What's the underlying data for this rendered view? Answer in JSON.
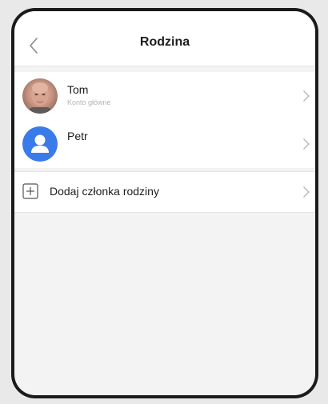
{
  "header": {
    "title": "Rodzina",
    "back_icon": "chevron-left-icon"
  },
  "members": [
    {
      "name": "Tom",
      "subtitle": "Konto główne",
      "avatar": "photo"
    },
    {
      "name": "Petr",
      "subtitle": "",
      "avatar": "default-user-icon"
    }
  ],
  "add_member": {
    "label": "Dodaj członka rodziny",
    "icon": "plus-box-icon"
  },
  "colors": {
    "accent": "#3a7bea",
    "background": "#f3f3f3",
    "frame": "#1b1b1b"
  }
}
